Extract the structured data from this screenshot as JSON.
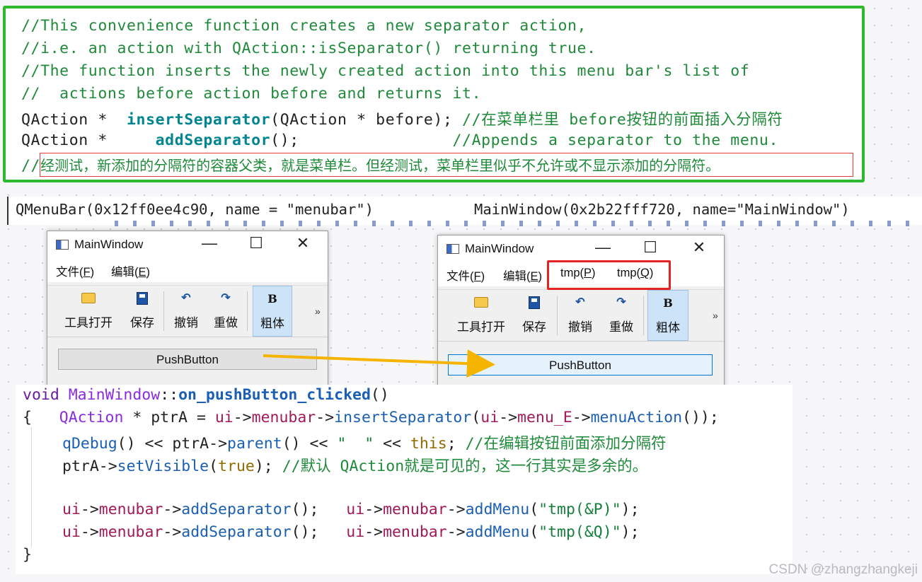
{
  "top_code": {
    "lines": [
      "//This convenience function creates a new separator action,",
      "//i.e. an action with QAction::isSeparator() returning true.",
      "//The function inserts the newly created action into this menu bar's list of",
      "//  actions before action before and returns it."
    ],
    "line5": {
      "type": "QAction *  ",
      "fn": "insertSeparator",
      "args": "(QAction * before); ",
      "comment": "//在菜单栏里 before按钮的前面插入分隔符"
    },
    "line6": {
      "type": "QAction *     ",
      "fn": "addSeparator",
      "args": "();                ",
      "comment": "//Appends a separator to the menu."
    },
    "line7": {
      "prefix": "//",
      "note": "经测试，新添加的分隔符的容器父类，就是菜单栏。但经测试，菜单栏里似乎不允许或不显示添加的分隔符。"
    }
  },
  "debug_output": {
    "left": "QMenuBar(0x12ff0ee4c90, name = \"menubar\")",
    "right": "MainWindow(0x2b22fff720, name=\"MainWindow\")"
  },
  "window_before": {
    "title": "MainWindow",
    "menus": [
      {
        "text": "文件(",
        "key": "F",
        "end": ")"
      },
      {
        "text": "编辑(",
        "key": "E",
        "end": ")"
      }
    ],
    "tools": [
      "工具打开",
      "保存",
      "撤销",
      "重做",
      "粗体"
    ],
    "more": "»",
    "push_button": "PushButton",
    "controls": {
      "min": "—",
      "max": "☐",
      "close": "✕"
    }
  },
  "window_after": {
    "title": "MainWindow",
    "menus": [
      {
        "text": "文件(",
        "key": "F",
        "end": ")"
      },
      {
        "text": "编辑(",
        "key": "E",
        "end": ")"
      },
      {
        "text": "tmp(",
        "key": "P",
        "end": ")"
      },
      {
        "text": "tmp(",
        "key": "Q",
        "end": ")"
      }
    ],
    "tools": [
      "工具打开",
      "保存",
      "撤销",
      "重做",
      "粗体"
    ],
    "more": "»",
    "push_button": "PushButton",
    "controls": {
      "min": "—",
      "max": "☐",
      "close": "✕"
    }
  },
  "bottom_code": {
    "l1": {
      "kw": "void ",
      "cls": "MainWindow",
      "sep": "::",
      "fn": "on_pushButton_clicked",
      "rest": "()"
    },
    "l2": {
      "brace": "{   ",
      "type": "QAction",
      "a": " * ptrA = ",
      "ui1": "ui",
      "arr1": "->",
      "m1": "menubar",
      "arr2": "->",
      "fn": "insertSeparator",
      "b": "(",
      "ui2": "ui",
      "arr3": "->",
      "m2": "menu_E",
      "arr4": "->",
      "fn2": "menuAction",
      "c": "());"
    },
    "l3": {
      "fn": "qDebug",
      "a": "() << ",
      "ptr": "ptrA",
      "arr": "->",
      "fn2": "parent",
      "b": "() << ",
      "str": "\"  \"",
      "c": " << ",
      "this": "this",
      "d": "; ",
      "comment": "//在编辑按钮前面添加分隔符"
    },
    "l4": {
      "ptr": "ptrA",
      "arr": "->",
      "fn": "setVisible",
      "a": "(",
      "bool": "true",
      "b": "); ",
      "comment": "//默认 QAction就是可见的，这一行其实是多余的。"
    },
    "l5": {
      "ui": "ui",
      "arr": "->",
      "m": "menubar",
      "arr2": "->",
      "fn": "addSeparator",
      "a": "();   ",
      "ui2": "ui",
      "arr3": "->",
      "m2": "menubar",
      "arr4": "->",
      "fn2": "addMenu",
      "b": "(",
      "str": "\"tmp(&P)\"",
      "c": ");"
    },
    "l6": {
      "ui": "ui",
      "arr": "->",
      "m": "menubar",
      "arr2": "->",
      "fn": "addSeparator",
      "a": "();   ",
      "ui2": "ui",
      "arr3": "->",
      "m2": "menubar",
      "arr4": "->",
      "fn2": "addMenu",
      "b": "(",
      "str": "\"tmp(&Q)\"",
      "c": ");"
    },
    "l7": "}"
  },
  "watermark": "CSDN @zhangzhangkeji",
  "colors": {
    "green_frame": "#2eb82e",
    "red_highlight": "#e32222",
    "arrow": "#f5b400"
  }
}
